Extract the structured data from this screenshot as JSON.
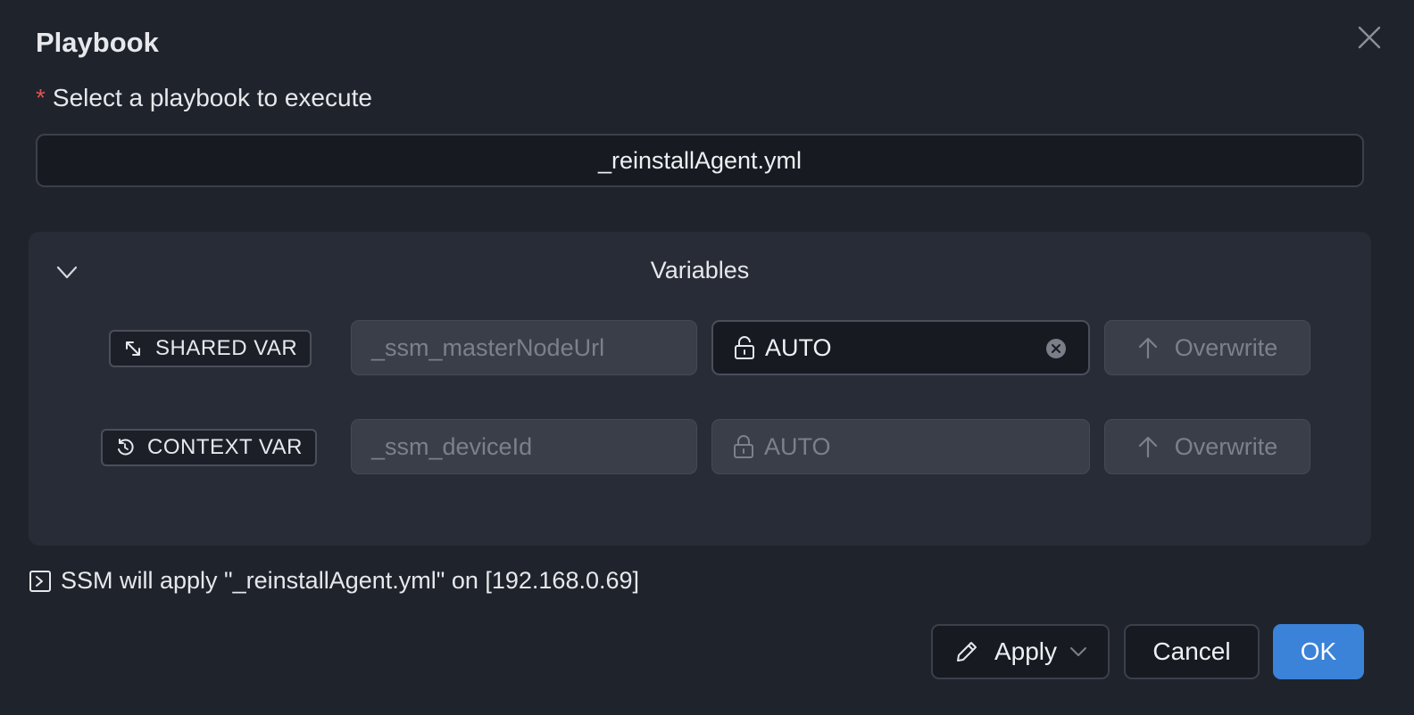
{
  "dialog": {
    "title": "Playbook",
    "required_mark": "*",
    "select_label": "Select a playbook to execute",
    "selected_playbook": "_reinstallAgent.yml"
  },
  "variables": {
    "title": "Variables",
    "rows": [
      {
        "tag": "SHARED VAR",
        "tag_icon": "shared-arrows-icon",
        "name": "_ssm_masterNodeUrl",
        "value": "AUTO",
        "value_icon": "unlock-icon",
        "editable": true,
        "action": "Overwrite"
      },
      {
        "tag": "CONTEXT VAR",
        "tag_icon": "context-refresh-icon",
        "name": "_ssm_deviceId",
        "value": "AUTO",
        "value_icon": "lock-icon",
        "editable": false,
        "action": "Overwrite"
      }
    ]
  },
  "info": {
    "text": "SSM will apply \"_reinstallAgent.yml\" on [192.168.0.69]"
  },
  "footer": {
    "apply_label": "Apply",
    "cancel_label": "Cancel",
    "ok_label": "OK"
  },
  "colors": {
    "background": "#1f232c",
    "panel": "#282c36",
    "primary": "#3b82d9",
    "required": "#e0524f"
  }
}
